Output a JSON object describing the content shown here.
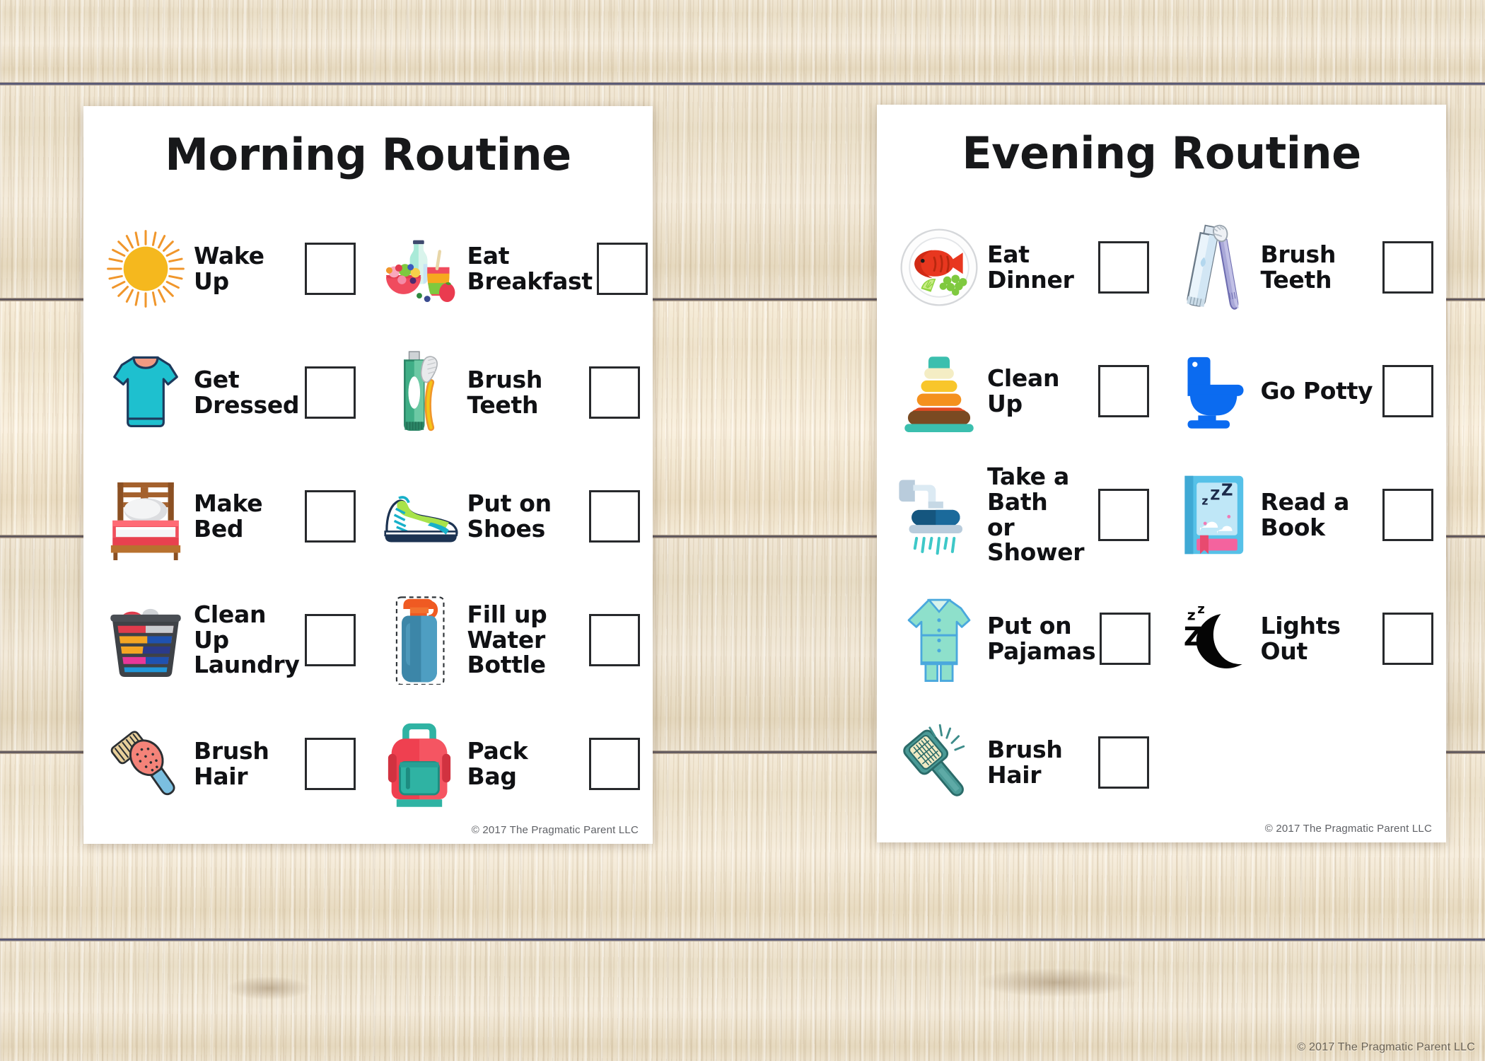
{
  "background": {
    "surface": "weathered-wood-planks",
    "color": "#efe5d2"
  },
  "page_watermark": "© 2017 The Pragmatic Parent LLC",
  "cards": [
    {
      "id": "morning",
      "title": "Morning Routine",
      "copyright": "© 2017 The Pragmatic Parent LLC",
      "rows": [
        {
          "left": {
            "label": "Wake Up",
            "icon": "sun-icon",
            "checked": false
          },
          "right": {
            "label": "Eat\nBreakfast",
            "icon": "breakfast-icon",
            "checked": false
          }
        },
        {
          "left": {
            "label": "Get Dressed",
            "icon": "tshirt-icon",
            "checked": false
          },
          "right": {
            "label": "Brush Teeth",
            "icon": "toothpaste-icon",
            "checked": false
          }
        },
        {
          "left": {
            "label": "Make Bed",
            "icon": "bed-icon",
            "checked": false
          },
          "right": {
            "label": "Put on Shoes",
            "icon": "sneaker-icon",
            "checked": false
          }
        },
        {
          "left": {
            "label": "Clean Up\nLaundry",
            "icon": "laundry-basket-icon",
            "checked": false
          },
          "right": {
            "label": "Fill up Water\nBottle",
            "icon": "water-bottle-icon",
            "checked": false
          }
        },
        {
          "left": {
            "label": "Brush Hair",
            "icon": "hairbrush-icon",
            "checked": false
          },
          "right": {
            "label": "Pack Bag",
            "icon": "backpack-icon",
            "checked": false
          }
        }
      ]
    },
    {
      "id": "evening",
      "title": "Evening Routine",
      "copyright": "© 2017 The Pragmatic Parent LLC",
      "rows": [
        {
          "left": {
            "label": "Eat Dinner",
            "icon": "dinner-plate-icon",
            "checked": false
          },
          "right": {
            "label": "Brush Teeth",
            "icon": "toothbrush-icon",
            "checked": false
          }
        },
        {
          "left": {
            "label": "Clean Up",
            "icon": "stacking-rings-icon",
            "checked": false
          },
          "right": {
            "label": "Go Potty",
            "icon": "toilet-icon",
            "checked": false
          }
        },
        {
          "left": {
            "label": "Take a Bath\nor Shower",
            "icon": "shower-icon",
            "checked": false
          },
          "right": {
            "label": "Read a Book",
            "icon": "book-icon",
            "checked": false
          }
        },
        {
          "left": {
            "label": "Put on\nPajamas",
            "icon": "pajamas-icon",
            "checked": false
          },
          "right": {
            "label": "Lights Out",
            "icon": "moon-icon",
            "checked": false
          }
        },
        {
          "left": {
            "label": "Brush Hair",
            "icon": "hair-brush-icon",
            "checked": false
          },
          "right": null
        }
      ]
    }
  ],
  "colors": {
    "card_background": "#ffffff",
    "text": "#101114",
    "checkbox_border": "#27292c",
    "sun_disc": "#f5b81e",
    "sun_rays": "#f0962b",
    "tshirt": "#1ec0cf",
    "toothpaste": "#3fae86",
    "bed_frame": "#a4612d",
    "bed_blanket": "#f04f5c",
    "laundry_basket": "#3e4247",
    "water_bottle": "#3c86a8",
    "backpack": "#ef4050",
    "fish": "#e8371f",
    "toilet": "#0b6bf0",
    "pajamas": "#8ee0cb",
    "moon": "#050505",
    "book": "#8fd3ef"
  }
}
